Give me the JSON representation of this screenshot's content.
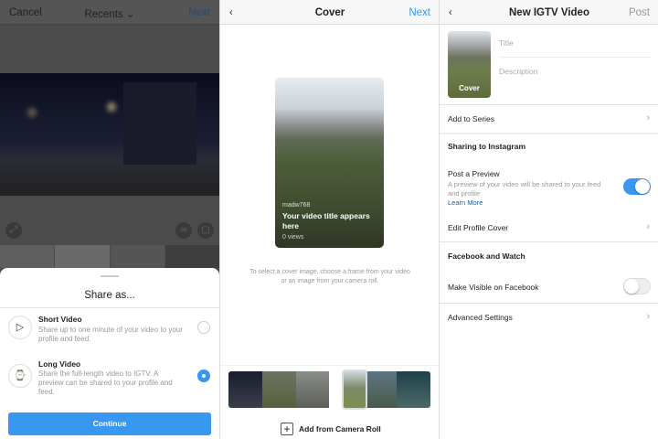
{
  "picker": {
    "cancel": "Cancel",
    "title": "Recents",
    "next": "Next",
    "sheet": {
      "title": "Share as...",
      "continue": "Continue",
      "options": [
        {
          "title": "Short Video",
          "desc": "Share up to one minute of your video to your profile and feed.",
          "selected": false,
          "icon": "play-icon"
        },
        {
          "title": "Long Video",
          "desc": "Share the full-length video to IGTV. A preview can be shared to your profile and feed.",
          "selected": true,
          "icon": "igtv-icon"
        }
      ]
    }
  },
  "cover": {
    "title": "Cover",
    "next": "Next",
    "username": "madw768",
    "video_title": "Your video title appears here",
    "views": "0 views",
    "hint": "To select a cover image, choose a frame from your video or an image from your camera roll.",
    "add_camera_roll": "Add from Camera Roll"
  },
  "igtv": {
    "title": "New IGTV Video",
    "post": "Post",
    "cover_label": "Cover",
    "title_placeholder": "Title",
    "description_placeholder": "Description",
    "add_to_series": "Add to Series",
    "sharing_header": "Sharing to Instagram",
    "post_preview": "Post a Preview",
    "post_preview_desc": "A preview of your video will be shared to your feed and profile",
    "learn_more": "Learn More",
    "post_preview_on": true,
    "edit_profile_cover": "Edit Profile Cover",
    "facebook_header": "Facebook and Watch",
    "make_visible": "Make Visible on Facebook",
    "make_visible_on": false,
    "advanced": "Advanced Settings"
  },
  "colors": {
    "accent": "#3897f0"
  }
}
